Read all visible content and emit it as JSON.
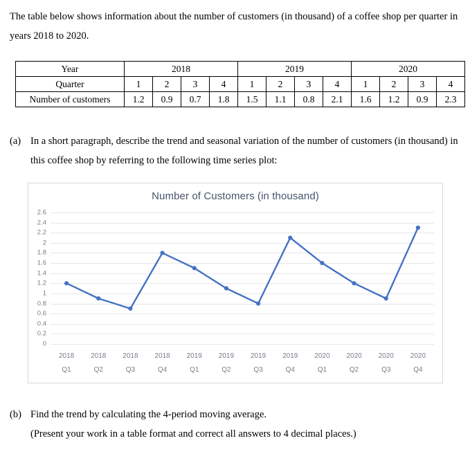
{
  "intro": {
    "text": "The table below shows information about the number of customers (in thousand) of a coffee shop per quarter in years 2018 to 2020."
  },
  "table": {
    "row_labels": [
      "Year",
      "Quarter",
      "Number of customers"
    ],
    "years": [
      "2018",
      "2019",
      "2020"
    ],
    "quarters": [
      "1",
      "2",
      "3",
      "4",
      "1",
      "2",
      "3",
      "4",
      "1",
      "2",
      "3",
      "4"
    ],
    "customers": [
      "1.2",
      "0.9",
      "0.7",
      "1.8",
      "1.5",
      "1.1",
      "0.8",
      "2.1",
      "1.6",
      "1.2",
      "0.9",
      "2.3"
    ]
  },
  "questions": {
    "a": {
      "marker": "(a)",
      "text": "In a short paragraph, describe the trend and seasonal variation of the number of customers (in thousand) in this coffee shop by referring to the following time series plot:"
    },
    "b": {
      "marker": "(b)",
      "line1": "Find the trend by calculating the 4-period moving average.",
      "line2": "(Present your work in a table format and correct all answers to 4 decimal places.)"
    }
  },
  "chart_data": {
    "type": "line",
    "title": "Number of Customers (in thousand)",
    "xlabel": "",
    "ylabel": "",
    "categories": [
      "2018 Q1",
      "2018 Q2",
      "2018 Q3",
      "2018 Q4",
      "2019 Q1",
      "2019 Q2",
      "2019 Q3",
      "2019 Q4",
      "2020 Q1",
      "2020 Q2",
      "2020 Q3",
      "2020 Q4"
    ],
    "category_years": [
      "2018",
      "2018",
      "2018",
      "2018",
      "2019",
      "2019",
      "2019",
      "2019",
      "2020",
      "2020",
      "2020",
      "2020"
    ],
    "category_quarters": [
      "Q1",
      "Q2",
      "Q3",
      "Q4",
      "Q1",
      "Q2",
      "Q3",
      "Q4",
      "Q1",
      "Q2",
      "Q3",
      "Q4"
    ],
    "values": [
      1.2,
      0.9,
      0.7,
      1.8,
      1.5,
      1.1,
      0.8,
      2.1,
      1.6,
      1.2,
      0.9,
      2.3
    ],
    "ylim": [
      0,
      2.6
    ],
    "ytick_step": 0.2,
    "yticks": [
      "2.6",
      "2.4",
      "2.2",
      "2",
      "1.8",
      "1.6",
      "1.4",
      "1.2",
      "1",
      "0.8",
      "0.6",
      "0.4",
      "0.2",
      "0"
    ],
    "grid": true,
    "legend": false,
    "series_color": "#4472c4",
    "marker_color": "#4472c4",
    "gridline_color": "#e6e6e6",
    "title_color": "#44546a",
    "tick_label_color": "#7b7b8c"
  }
}
